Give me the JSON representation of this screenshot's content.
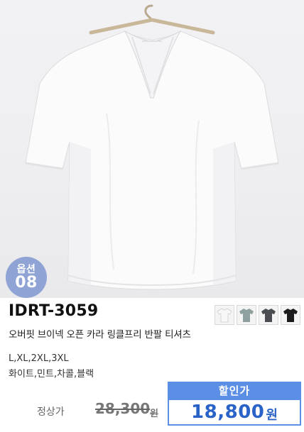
{
  "product": {
    "code": "IDRT-3059",
    "name": "오버핏 브이넥 오픈 카라 링클프리 반팔 티셔츠",
    "sizes": "L,XL,2XL,3XL",
    "colors": "화이트,민트,차콜,블랙"
  },
  "option_badge": {
    "label": "옵션",
    "number": "08"
  },
  "swatches": [
    {
      "name": "white",
      "color": "#f7f7f7"
    },
    {
      "name": "mint",
      "color": "#8fa0a0"
    },
    {
      "name": "charcoal",
      "color": "#4a4d52"
    },
    {
      "name": "black",
      "color": "#1b1b1d"
    }
  ],
  "pricing": {
    "regular_label": "정상가",
    "regular_price": "28,300",
    "regular_currency": "원",
    "sale_label": "할인가",
    "sale_price": "18,800",
    "sale_currency": "원"
  },
  "colors": {
    "badge": "#8fa3d4",
    "sale_accent": "#5b8fe6",
    "sale_text": "#2a63c8"
  }
}
